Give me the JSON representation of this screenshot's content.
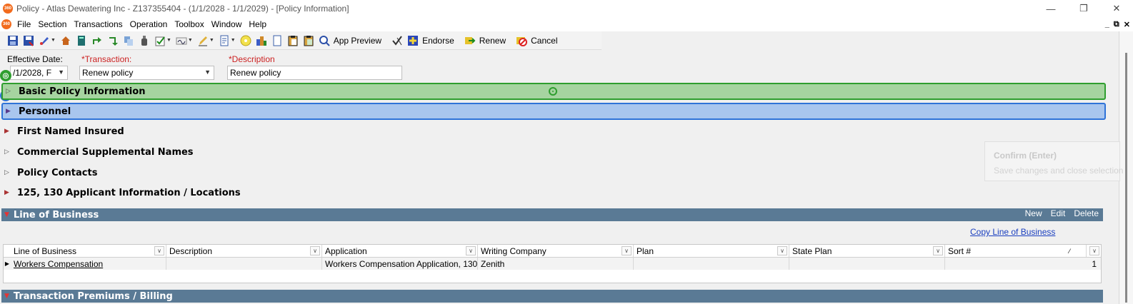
{
  "window": {
    "title": "Policy - Atlas Dewatering Inc - Z137355404 - (1/1/2028 - 1/1/2029) - [Policy Information]",
    "app_logo": "360",
    "controls": [
      "minimize-icon",
      "restore-icon",
      "close-icon"
    ]
  },
  "menu": {
    "app_logo": "360",
    "items": [
      "File",
      "Section",
      "Transactions",
      "Operation",
      "Toolbox",
      "Window",
      "Help"
    ],
    "mdi_controls": [
      "_",
      "⧉",
      "✕"
    ]
  },
  "toolbar": {
    "app_preview_label": "App Preview",
    "endorse_label": "Endorse",
    "renew_label": "Renew",
    "cancel_label": "Cancel"
  },
  "header_fields": {
    "effective_date_label": "Effective Date:",
    "effective_date_value": "/1/2028, F",
    "transaction_label": "*Transaction:",
    "transaction_value": "Renew policy",
    "description_label": "*Description",
    "description_value": "Renew policy"
  },
  "sections": [
    {
      "label": "Basic Policy Information",
      "state": "collapsed-hollow",
      "highlight": "green"
    },
    {
      "label": "Personnel",
      "state": "collapsed-filled",
      "highlight": "blue"
    },
    {
      "label": "First Named Insured",
      "state": "collapsed-filled"
    },
    {
      "label": "Commercial Supplemental Names",
      "state": "collapsed-hollow"
    },
    {
      "label": "Policy Contacts",
      "state": "collapsed-hollow"
    },
    {
      "label": "125, 130 Applicant Information / Locations",
      "state": "collapsed-filled"
    }
  ],
  "line_of_business": {
    "title": "Line of Business",
    "actions": [
      "New",
      "Edit",
      "Delete"
    ],
    "copy_link": "Copy Line of Business",
    "columns": [
      "Line of Business",
      "Description",
      "Application",
      "Writing Company",
      "Plan",
      "State Plan",
      "Sort #"
    ],
    "rows": [
      {
        "line_of_business": "Workers Compensation",
        "description": "",
        "application": "Workers Compensation Application, 130",
        "writing_company": "Zenith",
        "plan": "",
        "state_plan": "",
        "sort": "1"
      }
    ]
  },
  "transaction_premiums": {
    "title": "Transaction Premiums / Billing"
  },
  "confirm_overlay": {
    "title": "Confirm (Enter)",
    "subtitle": "Save changes and close selection"
  },
  "colors": {
    "section_green_bg": "#a6d4a0",
    "section_green_border": "#2f9e2f",
    "section_blue_bg": "#a9c6ee",
    "section_blue_border": "#2f73d8",
    "lob_header_bg": "#5a7a95",
    "required_label": "#cc2222",
    "link": "#1a3fbf"
  }
}
